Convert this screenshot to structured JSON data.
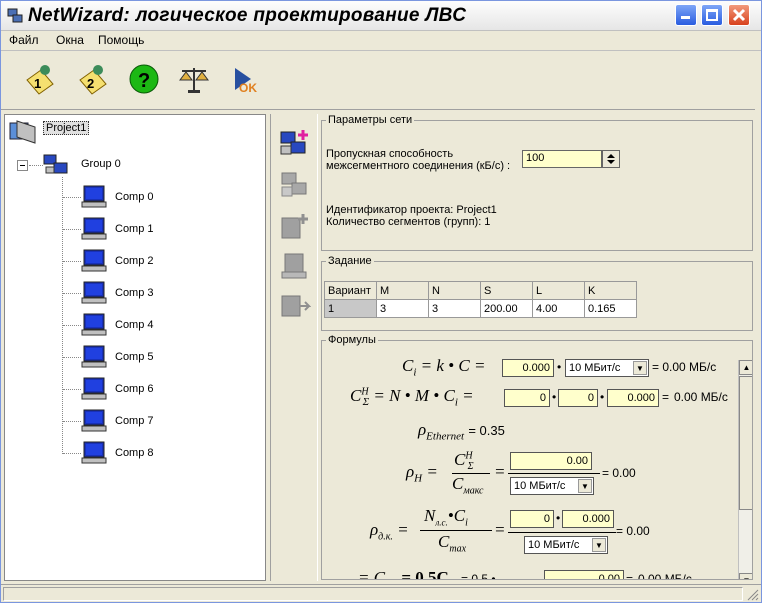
{
  "window": {
    "title": "NetWizard: логическое проектирование ЛВС"
  },
  "menu": [
    "Файл",
    "Окна",
    "Помощь"
  ],
  "tree": {
    "root": "Project1",
    "group": "Group 0",
    "comps": [
      "Comp 0",
      "Comp 1",
      "Comp 2",
      "Comp 3",
      "Comp 4",
      "Comp 5",
      "Comp 6",
      "Comp 7",
      "Comp 8"
    ]
  },
  "params": {
    "legend": "Параметры сети",
    "bandwidth_label_1": "Пропускная способность",
    "bandwidth_label_2": "межсегментного соединения  (кБ/с) :",
    "bandwidth_value": "100",
    "project_id": "Идентификатор проекта: Project1",
    "segments_count": "Количество сегментов (групп): 1"
  },
  "zadanie": {
    "legend": "Задание",
    "headers": [
      "Вариант",
      "M",
      "N",
      "S",
      "L",
      "K"
    ],
    "row": [
      "1",
      "3",
      "3",
      "200.00",
      "4.00",
      "0.165"
    ]
  },
  "formuly": {
    "legend": "Формулы",
    "f1": {
      "lhs": "C",
      "sub": "i",
      "eq": "= k • C =",
      "input": "0.000",
      "select": "10 МБит/с",
      "result": "= 0.00 МБ/с"
    },
    "f2": {
      "lhs": "C",
      "sup": "Н",
      "sub": "Σ",
      "eq": "= N • M • C",
      "sub2": "i",
      "eq2": "=",
      "in1": "0",
      "in2": "0",
      "in3": "0.000",
      "result": "0.00 МБ/с"
    },
    "f3": {
      "lhs": "ρ",
      "sub": "Ethernet",
      "eq": "= 0.35"
    },
    "f4": {
      "lhs": "ρ",
      "sub": "Н",
      "eq": "=",
      "num": "C",
      "num_sup": "Н",
      "num_sub": "Σ",
      "den": "C",
      "den_sub": "макс",
      "eq2": "=",
      "input": "0.00",
      "select": "10 МБит/с",
      "result": "= 0.00"
    },
    "f5": {
      "lhs": "ρ",
      "sub": "д.к.",
      "eq": "=",
      "num": "N",
      "num_sub": "л.с.",
      "num2": "•C",
      "num2_sub": "i",
      "den": "C",
      "den_sub": "max",
      "eq2": "=",
      "in1": "0",
      "in2": "0.000",
      "select": "10 МБит/с",
      "result": "= 0.00"
    },
    "f6": {
      "partial": "= C",
      "partial2": "= 0.5C",
      "partial3": "= 0.5 •",
      "input": "0.00",
      "result": "0.00 МБ/с"
    }
  },
  "colors": {
    "input_bg": "#ffffcc",
    "title_close": "#d8421e",
    "title_btn": "#2a5ce0"
  }
}
